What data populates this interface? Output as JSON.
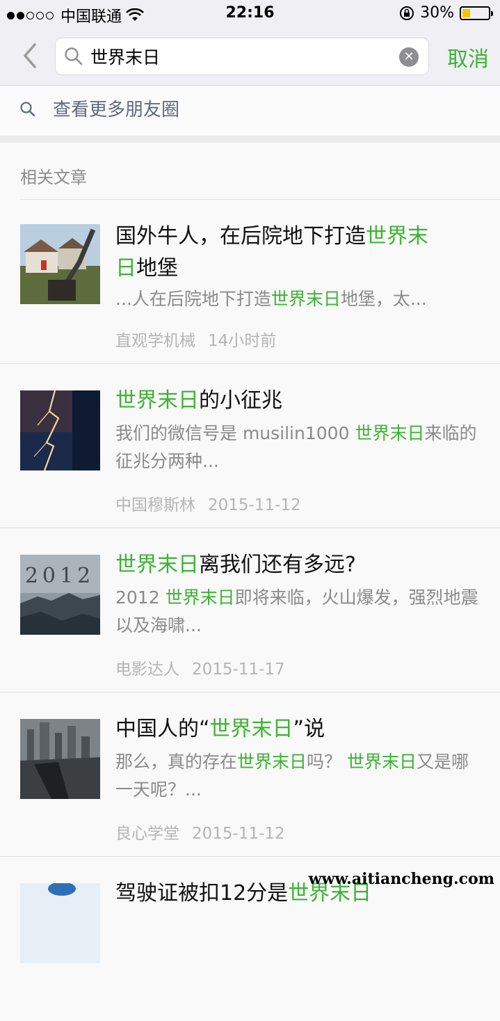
{
  "status_bar": {
    "carrier": "中国联通",
    "time": "22:16",
    "battery_percent": "30%",
    "battery_level": 0.3,
    "signal_full": 2,
    "signal_total": 5
  },
  "search": {
    "query": "世界末日",
    "cancel_label": "取消"
  },
  "more_moments": {
    "label": "查看更多朋友圈"
  },
  "section": {
    "title": "相关文章"
  },
  "accent_color": "#3db334",
  "articles": [
    {
      "title_1": "国外牛人，在后院地下打造",
      "title_hl": "世界末",
      "title_2": "日",
      "title_line2_hl": "日",
      "title_line2": "地堡",
      "snippet_pre": "...人在后院地下打造",
      "snippet_hl": "世界末日",
      "snippet_post": "地堡，太...",
      "source": "直观学机械",
      "time": "14小时前"
    },
    {
      "title_hl": "世界末日",
      "title_post": "的小征兆",
      "snippet_pre": "我们的微信号是 musilin1000 ",
      "snippet_hl": "世界末日",
      "snippet_post": "来临的征兆分两种...",
      "source": "中国穆斯林",
      "time": "2015-11-12"
    },
    {
      "title_hl": "世界末日",
      "title_post": "离我们还有多远?",
      "snippet_pre": "2012 ",
      "snippet_hl": "世界末日",
      "snippet_post": "即将来临，火山爆发，强烈地震以及海啸...",
      "source": "电影达人",
      "time": "2015-11-17"
    },
    {
      "title_pre": "中国人的“",
      "title_hl": "世界末日",
      "title_post": "”说",
      "snippet_pre": "那么，真的存在",
      "snippet_hl": "世界末日",
      "snippet_mid": "吗？ ",
      "snippet_hl2": "世界末日",
      "snippet_post": "又是哪一天呢？...",
      "source": "良心学堂",
      "time": "2015-11-12"
    },
    {
      "title_pre": "驾驶证被扣12分是",
      "title_hl": "世界末日"
    }
  ],
  "watermark": "www.aitiancheng.com"
}
